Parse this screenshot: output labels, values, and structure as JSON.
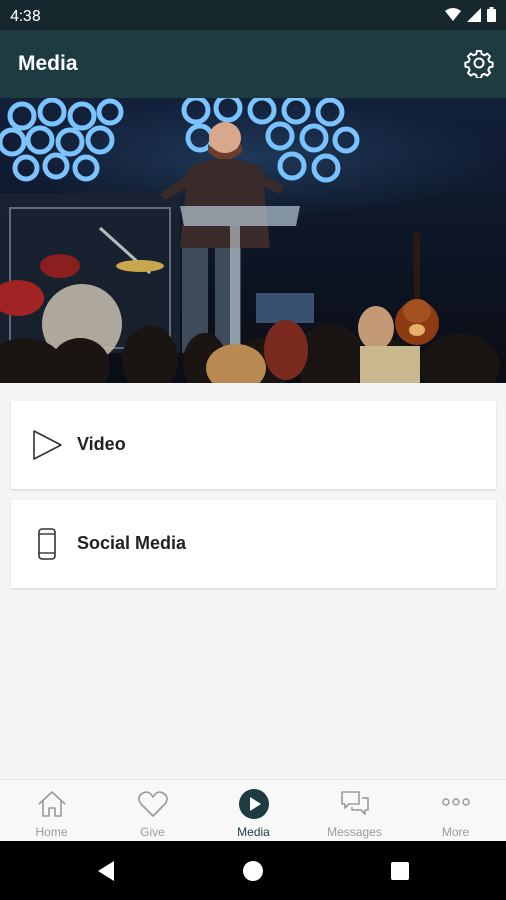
{
  "status_bar": {
    "time": "4:38"
  },
  "app_bar": {
    "title": "Media"
  },
  "menu": [
    {
      "label": "Video",
      "icon": "play-outline-icon"
    },
    {
      "label": "Social Media",
      "icon": "smartphone-icon"
    }
  ],
  "bottom_nav": {
    "items": [
      {
        "label": "Home",
        "icon": "home-icon",
        "active": false
      },
      {
        "label": "Give",
        "icon": "heart-icon",
        "active": false
      },
      {
        "label": "Media",
        "icon": "play-circle-icon",
        "active": true
      },
      {
        "label": "Messages",
        "icon": "chat-bubbles-icon",
        "active": false
      },
      {
        "label": "More",
        "icon": "more-dots-icon",
        "active": false
      }
    ]
  },
  "colors": {
    "app_bar": "#1e3b42",
    "status_bar": "#16282d",
    "background": "#f5f5f5",
    "active_tab": "#1e3b42"
  }
}
